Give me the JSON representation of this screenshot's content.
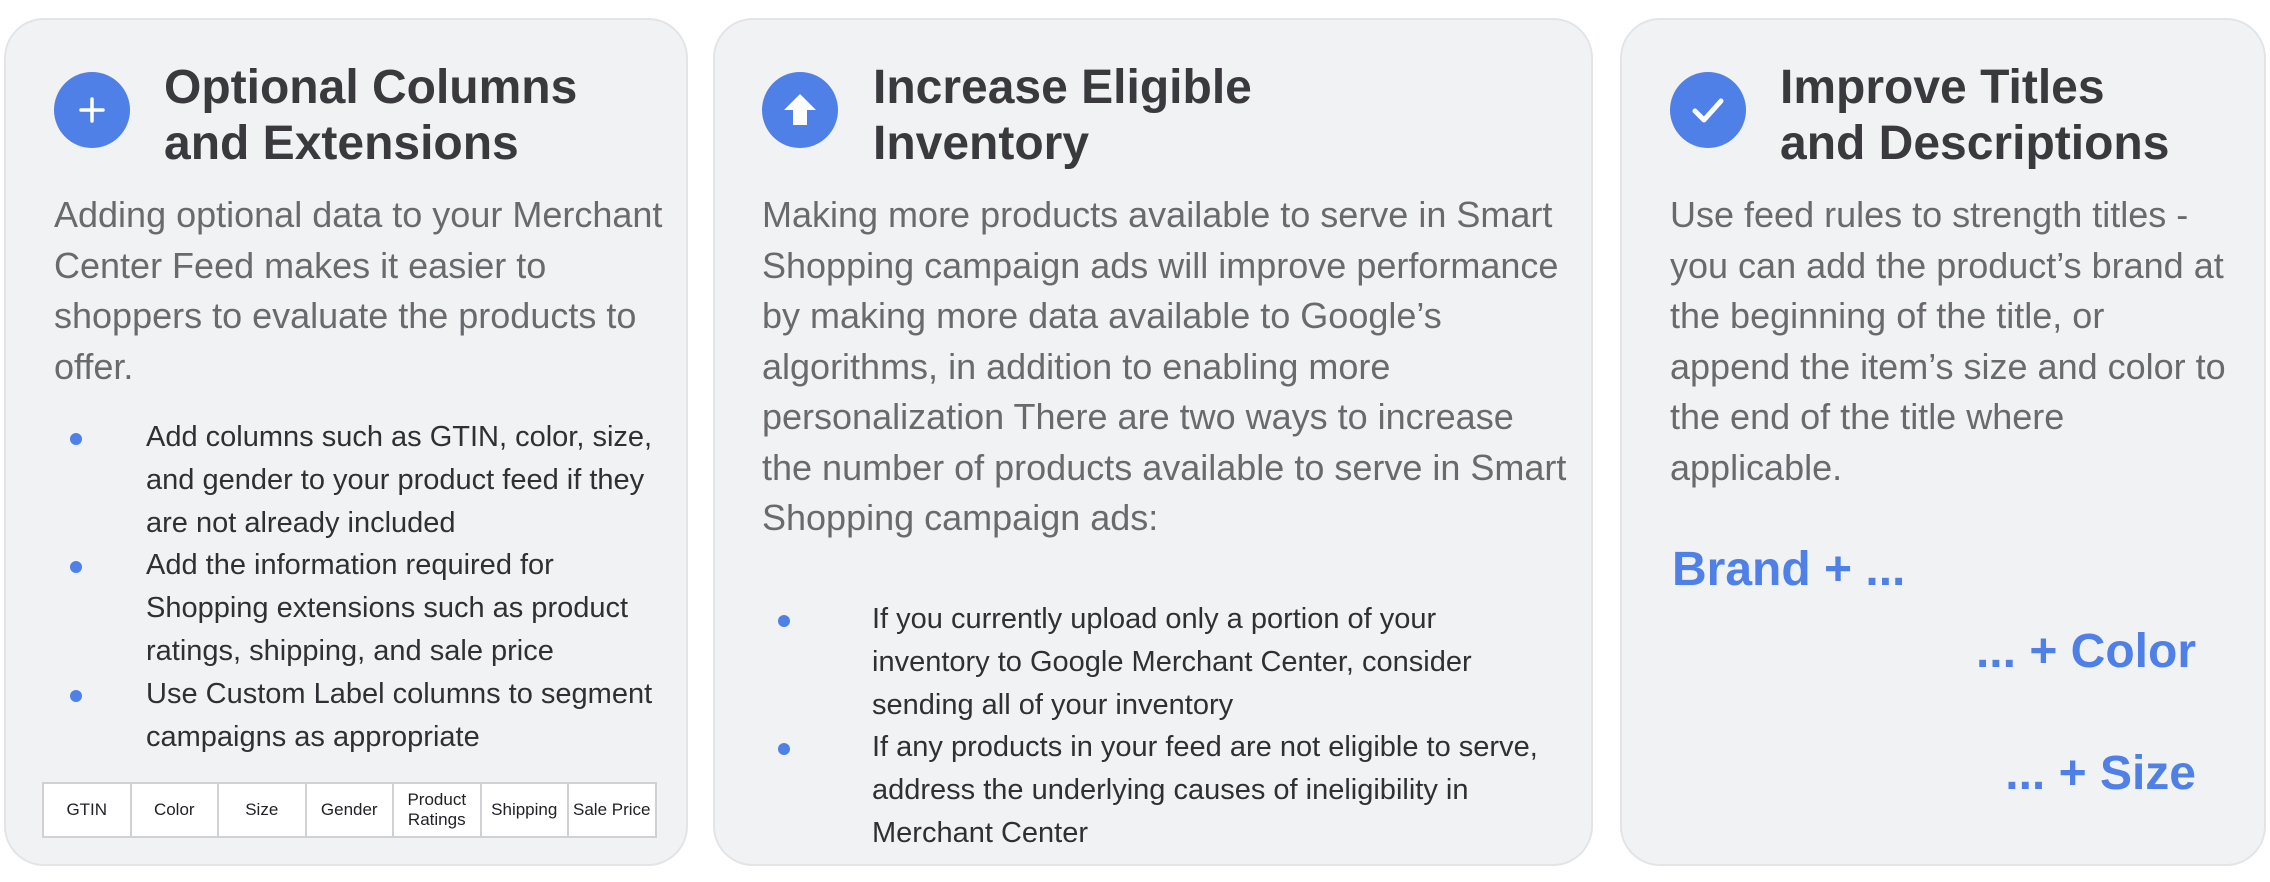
{
  "cards": [
    {
      "icon": "plus-icon",
      "title": "Optional Columns\nand Extensions",
      "intro": "Adding optional data to your Merchant Center Feed makes it easier to shoppers to evaluate the products to offer.",
      "bullets": [
        "Add columns such as GTIN, color, size, and gender to your product feed if they are not already included",
        "Add the information required for Shopping extensions such as product ratings, shipping, and sale price",
        "Use Custom Label columns to segment campaigns as appropriate"
      ],
      "table_columns": [
        "GTIN",
        "Color",
        "Size",
        "Gender",
        "Product Ratings",
        "Shipping",
        "Sale Price"
      ]
    },
    {
      "icon": "arrow-up-icon",
      "title": "Increase Eligible\nInventory",
      "intro": "Making more products available to serve in Smart Shopping campaign ads will improve performance by making more data available to Google’s algorithms, in addition to enabling more personalization There are two ways to increase the number of products available to serve in Smart Shopping campaign ads:",
      "bullets": [
        "If you currently upload only a portion of your inventory to Google Merchant Center, consider sending all of your inventory",
        "If any products in your feed are not eligible to serve, address the underlying causes of ineligibility in Merchant Center"
      ]
    },
    {
      "icon": "checkmark-icon",
      "title": "Improve Titles\nand Descriptions",
      "intro": "Use feed rules to strength titles - you can add the product’s brand at the beginning of the title, or append the item’s size and color to the end of the title where applicable.",
      "formula": {
        "brand": "Brand + ...",
        "color": "... + Color",
        "size": "... + Size"
      }
    }
  ],
  "colors": {
    "accent": "#4e80e8",
    "card_background": "#f1f2f4",
    "title_text": "#3a3a3e",
    "body_text": "#6a6a6e"
  }
}
